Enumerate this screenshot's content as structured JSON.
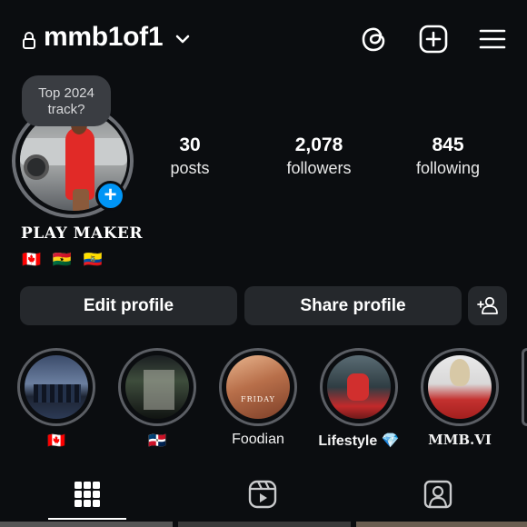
{
  "header": {
    "username": "mmb1of1",
    "icons": [
      "lock-icon",
      "chevron-down-icon",
      "threads-icon",
      "new-post-icon",
      "menu-icon"
    ]
  },
  "profile": {
    "note_line1": "Top 2024",
    "note_line2": "track?",
    "stats": {
      "posts_count": "30",
      "posts_label": "posts",
      "followers_count": "2,078",
      "followers_label": "followers",
      "following_count": "845",
      "following_label": "following"
    },
    "display_name": "PLAY MAKER",
    "flags": "🇨🇦 🇬🇭 🇪🇨"
  },
  "buttons": {
    "edit_profile": "Edit profile",
    "share_profile": "Share profile",
    "discover_people_icon": "add-person-icon"
  },
  "highlights": [
    {
      "caption": "🇨🇦"
    },
    {
      "caption": "🇩🇴"
    },
    {
      "caption": "Foodian",
      "cover_text": "FRIDAY"
    },
    {
      "caption": "Lifestyle 💎"
    },
    {
      "caption": "MMB.VI"
    }
  ],
  "tabs": [
    "grid-icon",
    "reels-icon",
    "tagged-icon"
  ],
  "colors": {
    "background": "#0b0d10",
    "button_bg": "#25282c",
    "accent_blue": "#0095f6",
    "ring_gray": "#6c6f75"
  }
}
